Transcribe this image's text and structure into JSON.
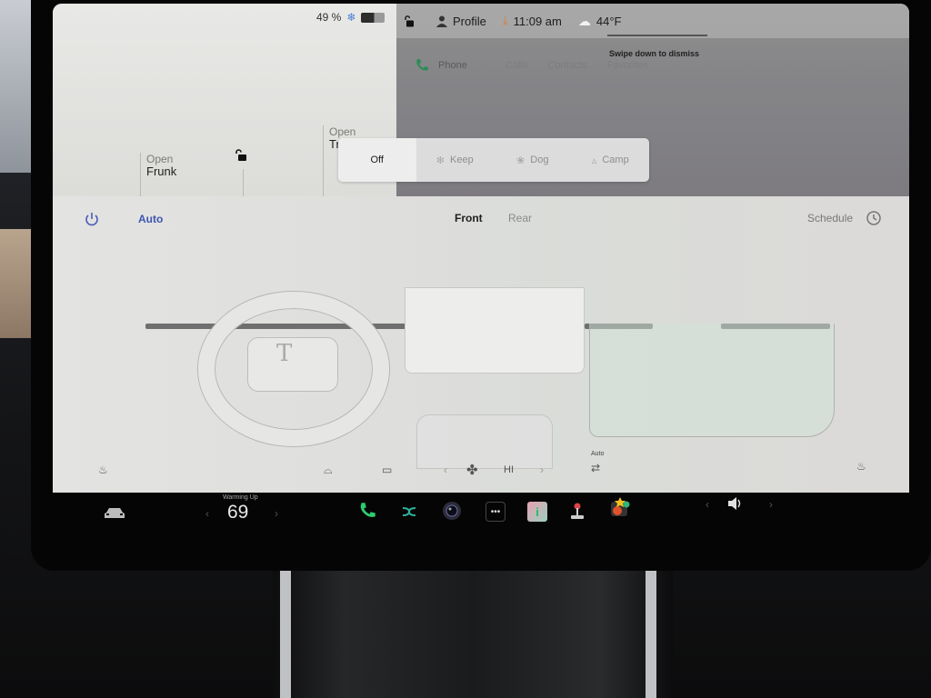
{
  "status": {
    "battery_percent": "49 %",
    "profile_label": "Profile",
    "time": "11:09 am",
    "temperature_outside": "44°F"
  },
  "car_controls": {
    "frunk": {
      "action": "Open",
      "label": "Frunk"
    },
    "trunk": {
      "action": "Open",
      "label": "Tr"
    }
  },
  "phone": {
    "swipe_hint": "Swipe down to dismiss",
    "title": "Phone",
    "tabs": [
      "Calls",
      "Contacts",
      "Favorites"
    ]
  },
  "climate_keep_modes": {
    "options": [
      {
        "label": "Off",
        "icon": "none",
        "active": true
      },
      {
        "label": "Keep",
        "icon": "fan-icon",
        "active": false
      },
      {
        "label": "Dog",
        "icon": "paw-icon",
        "active": false
      },
      {
        "label": "Camp",
        "icon": "tent-icon",
        "active": false
      }
    ]
  },
  "climate": {
    "auto_label": "Auto",
    "tabs": [
      {
        "label": "Front",
        "active": true
      },
      {
        "label": "Rear",
        "active": false
      }
    ],
    "schedule_label": "Schedule",
    "fan_speed": "HI",
    "recirc_auto_label": "Auto"
  },
  "dock": {
    "warming_label": "Warming Up",
    "set_temp": "69",
    "apps": [
      "phone-icon",
      "shuffle-icon",
      "camera-icon",
      "more-icon",
      "manual-icon",
      "joystick-icon",
      "toybox-icon"
    ]
  },
  "colors": {
    "accent_blue": "#3f55b0",
    "phone_green": "#2ecc71",
    "snow_blue": "#4a7fd8"
  }
}
